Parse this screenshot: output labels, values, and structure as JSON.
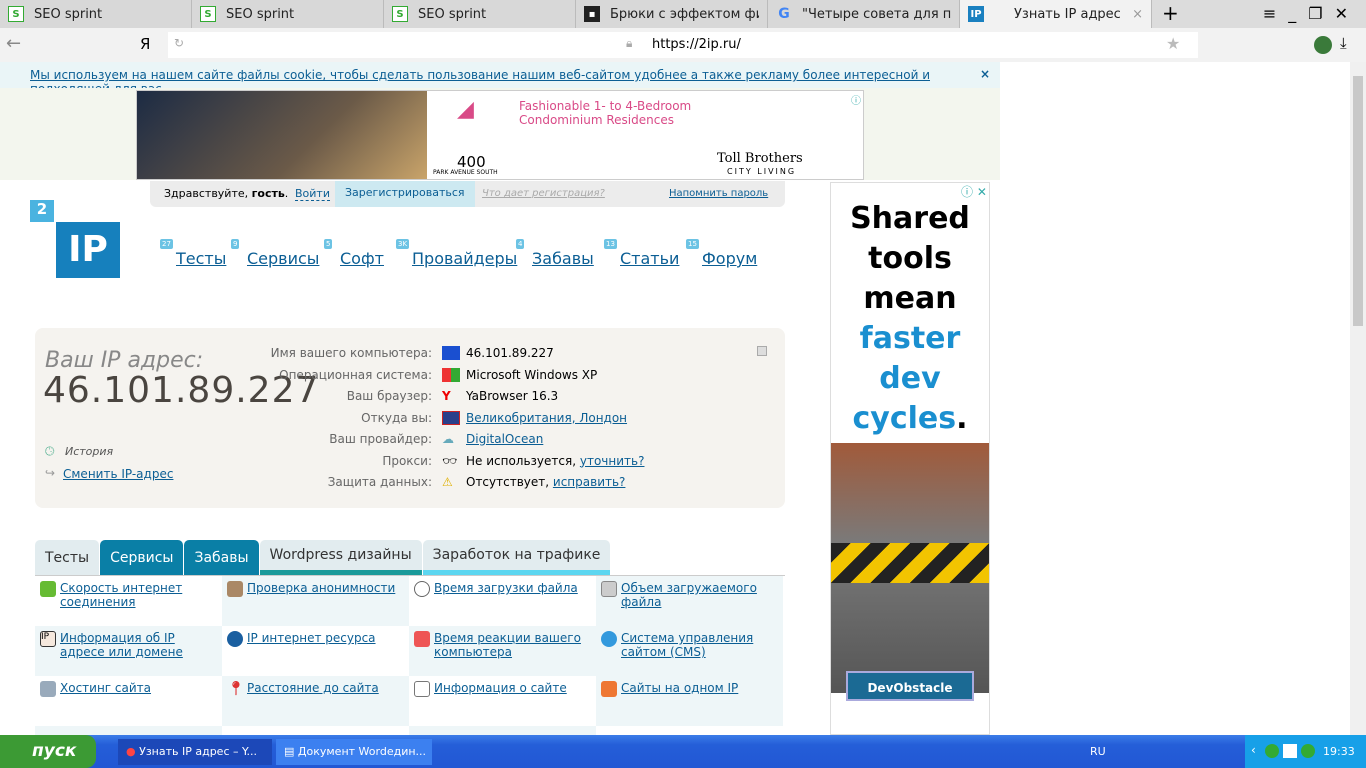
{
  "browser": {
    "tabs": [
      {
        "title": "SEO sprint",
        "icon": "seosprint-icon"
      },
      {
        "title": "SEO sprint",
        "icon": "seosprint-icon"
      },
      {
        "title": "SEO sprint",
        "icon": "seosprint-icon"
      },
      {
        "title": "Брюки с эффектом фитнес",
        "icon": "site-icon"
      },
      {
        "title": "\"Четыре совета для подгот",
        "icon": "google-icon"
      },
      {
        "title": "Узнать IP адрес",
        "icon": "2ip-icon",
        "active": true
      }
    ],
    "url": "https://2ip.ru/",
    "yandex_button": "Я"
  },
  "cookie_notice": "Мы используем на нашем сайте файлы cookie, чтобы сделать пользование нашим веб-сайтом удобнее а также рекламу более интересной и подходящей для вас.",
  "top_ad": {
    "headline": "Fashionable 1- to 4-Bedroom Condominium Residences",
    "brand": "400",
    "brand_sub": "PARK AVENUE SOUTH",
    "advertiser": "Toll Brothers",
    "advertiser_sub": "CITY LIVING"
  },
  "side_ad": {
    "line1": "Shared",
    "line2": "tools",
    "line3": "mean",
    "line4": "faster",
    "line5": "dev",
    "line6": "cycles",
    "dot": ".",
    "button": "DevObstacle"
  },
  "auth": {
    "greeting": "Здравствуйте,",
    "guest": "гость",
    "login": "Войти",
    "register": "Зарегистрироваться",
    "why": "Что дает регистрация?",
    "remind": "Напомнить пароль"
  },
  "logo": {
    "top": "2",
    "main": "IP"
  },
  "nav": [
    {
      "label": "Тесты",
      "count": "27"
    },
    {
      "label": "Сервисы",
      "count": "9"
    },
    {
      "label": "Софт",
      "count": "5"
    },
    {
      "label": "Провайдеры",
      "count": "3K"
    },
    {
      "label": "Забавы",
      "count": "4"
    },
    {
      "label": "Статьи",
      "count": "13"
    },
    {
      "label": "Форум",
      "count": "15"
    }
  ],
  "ip": {
    "heading": "Ваш IP адрес:",
    "address": "46.101.89.227",
    "history": "История",
    "change": "Сменить IP-адрес",
    "rows": [
      {
        "label": "Имя вашего компьютера:",
        "value": "46.101.89.227",
        "icon": "computer-icon"
      },
      {
        "label": "Операционная система:",
        "value": "Microsoft Windows XP",
        "icon": "windows-icon"
      },
      {
        "label": "Ваш браузер:",
        "value": "YaBrowser 16.3",
        "icon": "yandex-browser-icon"
      },
      {
        "label": "Откуда вы:",
        "value": "Великобритания, Лондон",
        "icon": "uk-flag-icon",
        "link": true
      },
      {
        "label": "Ваш провайдер:",
        "value": "DigitalOcean",
        "icon": "cloud-icon",
        "link": true
      },
      {
        "label": "Прокси:",
        "value": "Не используется,",
        "extra": "уточнить?",
        "icon": "glasses-icon"
      },
      {
        "label": "Защита данных:",
        "value": "Отсутствует,",
        "extra": "исправить?",
        "icon": "warning-icon"
      }
    ]
  },
  "section_tabs": [
    "Тесты",
    "Сервисы",
    "Забавы",
    "Wordpress дизайны",
    "Заработок на трафике"
  ],
  "services": [
    "Скорость интернет соединения",
    "Проверка анонимности",
    "Время загрузки файла",
    "Объем загружаемого файла",
    "Информация об IP адресе или домене",
    "IP интернет ресурса",
    "Время реакции вашего компьютера",
    "Система управления сайтом (CMS)",
    "Хостинг сайта",
    "Расстояние до сайта",
    "Информация о сайте",
    "Сайты на одном IP"
  ],
  "taskbar": {
    "start": "пуск",
    "tasks": [
      "Узнать IP адрес – Y...",
      "Документ Wordедин..."
    ],
    "lang": "RU",
    "time": "19:33"
  },
  "colors": {
    "link": "#0b5e94",
    "tab_active": "#0a7fa6",
    "taskbar": "#245ed8",
    "start": "#3c9a34"
  }
}
